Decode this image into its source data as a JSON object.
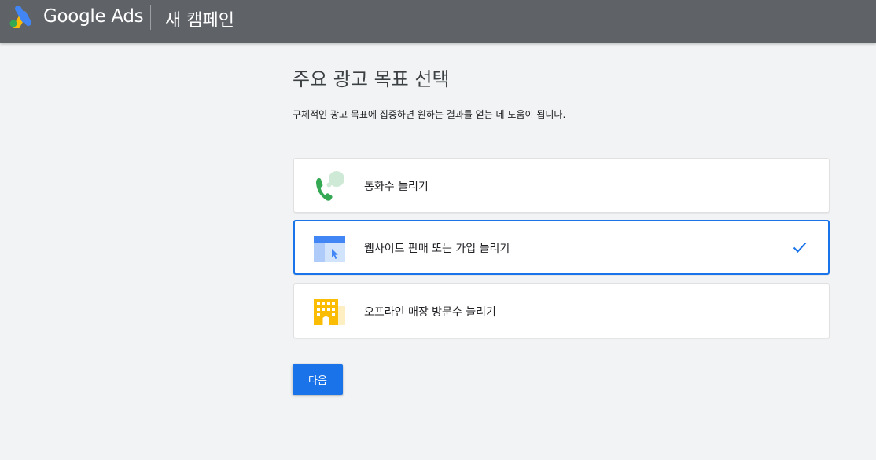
{
  "header": {
    "brand": "Google Ads",
    "campaign_title": "새 캠페인",
    "logo_icon": "google-ads-logo-icon"
  },
  "main": {
    "title": "주요 광고 목표 선택",
    "subtitle": "구체적인 광고 목표에 집중하면 원하는 결과를 얻는 데 도움이 됩니다.",
    "options": [
      {
        "label": "통화수 늘리기",
        "icon": "phone-call-icon",
        "selected": false
      },
      {
        "label": "웹사이트 판매 또는 가입 늘리기",
        "icon": "website-click-icon",
        "selected": true
      },
      {
        "label": "오프라인 매장 방문수 늘리기",
        "icon": "store-building-icon",
        "selected": false
      }
    ],
    "next_label": "다음"
  },
  "colors": {
    "header_bg": "#5f6368",
    "page_bg": "#f1f3f4",
    "accent": "#1a73e8",
    "phone_green": "#34a853",
    "store_yellow": "#fbbc04"
  }
}
